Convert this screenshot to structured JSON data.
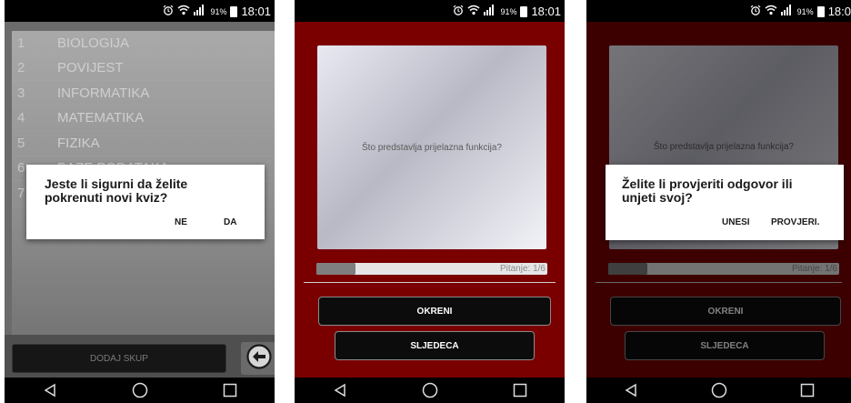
{
  "status_bar": {
    "battery": "91%",
    "time": "18:01",
    "time_cropped": "18:0"
  },
  "screen1": {
    "list": [
      {
        "num": "1",
        "label": "BIOLOGIJA"
      },
      {
        "num": "2",
        "label": "POVIJEST"
      },
      {
        "num": "3",
        "label": "INFORMATIKA"
      },
      {
        "num": "4",
        "label": "MATEMATIKA"
      },
      {
        "num": "5",
        "label": "FIZIKA"
      },
      {
        "num": "6",
        "label": "BAZE PODATAKA"
      },
      {
        "num": "7",
        "label": ""
      }
    ],
    "add_button": "DODAJ SKUP",
    "dialog": {
      "message": "Jeste li sigurni da želite pokrenuti novi kviz?",
      "no": "NE",
      "yes": "DA"
    }
  },
  "screen2": {
    "question": "Što predstavlja prijelazna funkcija?",
    "progress_label": "Pitanje: 1/6",
    "progress_value": 0.17,
    "flip_button": "OKRENI",
    "next_button": "SLJEDECA"
  },
  "screen3": {
    "question": "Što predstavlja prijelazna funkcija?",
    "progress_label": "Pitanje: 1/6",
    "flip_button": "OKRENI",
    "next_button": "SLJEDECA",
    "dialog": {
      "message": "Želite li provjeriti odgovor ili unjeti svoj?",
      "enter": "UNESI",
      "check": "PROVJERI."
    }
  },
  "icons": [
    "alarm-icon",
    "wifi-icon",
    "signal-icon",
    "battery-icon",
    "back-arrow-icon",
    "nav-back-icon",
    "nav-home-icon",
    "nav-recents-icon"
  ],
  "colors": {
    "quiz_background": "#7a0000",
    "list_background": "#9a9a9a"
  }
}
